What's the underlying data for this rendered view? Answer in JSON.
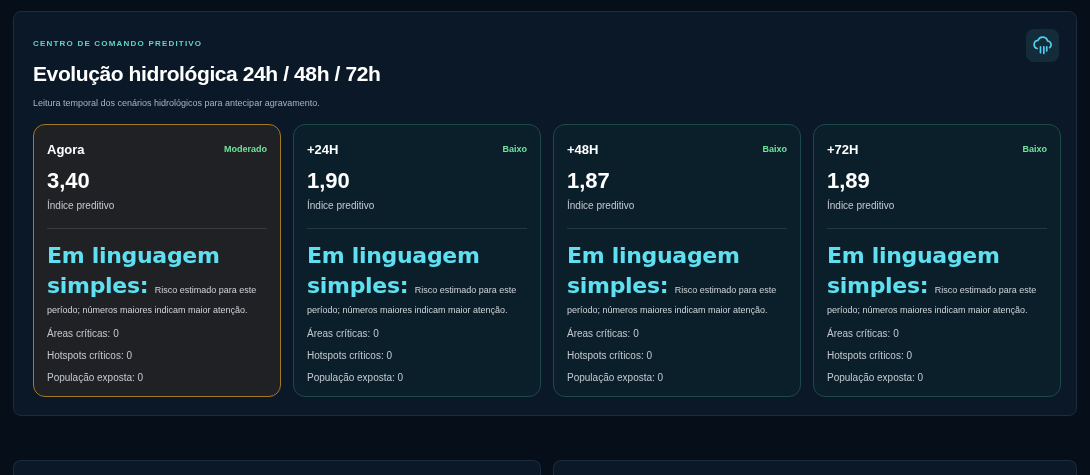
{
  "header": {
    "eyebrow": "CENTRO DE COMANDO PREDITIVO",
    "title": "Evolução hidrológica 24h / 48h / 72h",
    "subtitle": "Leitura temporal dos cenários hidrológicos para antecipar agravamento."
  },
  "cards": [
    {
      "period": "Agora",
      "risk": "Moderado",
      "value": "3,40",
      "value_label": "Índice preditivo",
      "explanation": "**Em linguagem simples:** Risco estimado para este período; números maiores indicam maior atenção.",
      "stats": [
        "Áreas críticas: 0",
        "Hotspots críticos: 0",
        "População exposta: 0"
      ],
      "selected": true
    },
    {
      "period": "+24H",
      "risk": "Baixo",
      "value": "1,90",
      "value_label": "Índice preditivo",
      "explanation": "**Em linguagem simples:** Risco estimado para este período; números maiores indicam maior atenção.",
      "stats": [
        "Áreas críticas: 0",
        "Hotspots críticos: 0",
        "População exposta: 0"
      ],
      "selected": false
    },
    {
      "period": "+48H",
      "risk": "Baixo",
      "value": "1,87",
      "value_label": "Índice preditivo",
      "explanation": "**Em linguagem simples:** Risco estimado para este período; números maiores indicam maior atenção.",
      "stats": [
        "Áreas críticas: 0",
        "Hotspots críticos: 0",
        "População exposta: 0"
      ],
      "selected": false
    },
    {
      "period": "+72H",
      "risk": "Baixo",
      "value": "1,89",
      "value_label": "Índice preditivo",
      "explanation": "**Em linguagem simples:** Risco estimado para este período; números maiores indicam maior atenção.",
      "stats": [
        "Áreas críticas: 0",
        "Hotspots críticos: 0",
        "População exposta: 0"
      ],
      "selected": false
    }
  ]
}
